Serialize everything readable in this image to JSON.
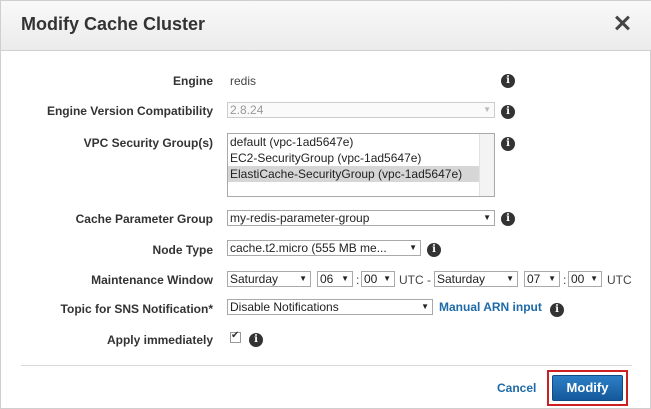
{
  "dialog": {
    "title": "Modify Cache Cluster",
    "close_label": "×"
  },
  "fields": {
    "engine": {
      "label": "Engine",
      "value": "redis"
    },
    "engine_version": {
      "label": "Engine Version Compatibility",
      "value": "2.8.24",
      "disabled": true
    },
    "vpc_security_groups": {
      "label": "VPC Security Group(s)",
      "options": [
        {
          "text": "default (vpc-1ad5647e)",
          "selected": false
        },
        {
          "text": "EC2-SecurityGroup (vpc-1ad5647e)",
          "selected": false
        },
        {
          "text": "ElastiCache-SecurityGroup (vpc-1ad5647e)",
          "selected": true
        }
      ]
    },
    "cache_parameter_group": {
      "label": "Cache Parameter Group",
      "value": "my-redis-parameter-group"
    },
    "node_type": {
      "label": "Node Type",
      "value": "cache.t2.micro (555 MB me..."
    },
    "maintenance_window": {
      "label": "Maintenance Window",
      "start_day": "Saturday",
      "start_hour": "06",
      "start_minute": "00",
      "tz1": "UTC -",
      "end_day": "Saturday",
      "end_hour": "07",
      "end_minute": "00",
      "tz2": "UTC",
      "colon": ":"
    },
    "sns_topic": {
      "label": "Topic for SNS Notification*",
      "value": "Disable Notifications",
      "link": "Manual ARN input"
    },
    "apply_immediately": {
      "label": "Apply immediately",
      "checked": true
    }
  },
  "info_glyph": "i",
  "dropdown_glyph": "▼",
  "footer": {
    "cancel_label": "Cancel",
    "modify_label": "Modify"
  },
  "colors": {
    "accent": "#1e6aa8",
    "primary_button": "#1a66ad",
    "highlight_border": "#cc1f1f"
  }
}
